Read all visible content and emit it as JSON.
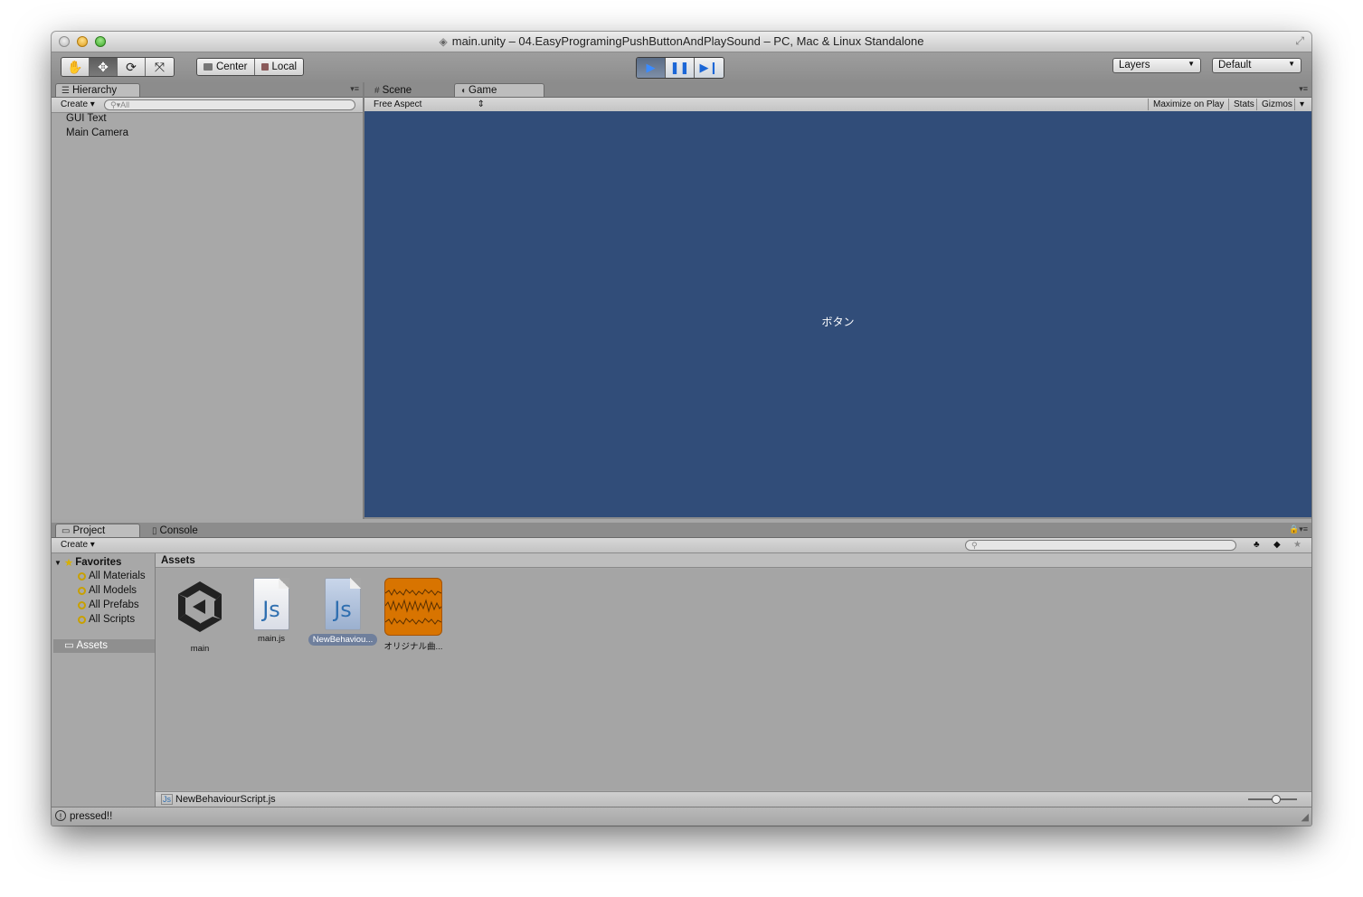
{
  "window": {
    "title": "main.unity – 04.EasyProgramingPushButtonAndPlaySound – PC, Mac & Linux Standalone"
  },
  "toolbar": {
    "transform_tools": [
      "hand-icon",
      "move-icon",
      "rotate-icon",
      "scale-icon"
    ],
    "active_tool": "move-icon",
    "pivot_label": "Center",
    "space_label": "Local",
    "play_controls": [
      "play-icon",
      "pause-icon",
      "step-icon"
    ],
    "layers_label": "Layers",
    "layout_label": "Default"
  },
  "hierarchy": {
    "tab_label": "Hierarchy",
    "create_label": "Create",
    "search_placeholder": "All",
    "items": [
      "GUI Text",
      "Main Camera"
    ]
  },
  "scene_tab": {
    "label": "Scene"
  },
  "game": {
    "tab_label": "Game",
    "aspect_label": "Free Aspect",
    "maximize_label": "Maximize on Play",
    "stats_label": "Stats",
    "gizmos_label": "Gizmos",
    "background_color": "#314d79",
    "button_text": "ボタン"
  },
  "project": {
    "tab_label": "Project",
    "console_tab_label": "Console",
    "create_label": "Create",
    "favorites_label": "Favorites",
    "favorites": [
      "All Materials",
      "All Models",
      "All Prefabs",
      "All Scripts"
    ],
    "assets_folder_label": "Assets",
    "breadcrumb": "Assets",
    "assets": [
      {
        "label": "main",
        "icon": "unity-scene-icon"
      },
      {
        "label": "main.js",
        "icon": "js-file-icon"
      },
      {
        "label": "NewBehaviou...",
        "icon": "js-file-icon",
        "selected": true
      },
      {
        "label": "オリジナル曲...",
        "icon": "audio-clip-icon"
      }
    ],
    "selected_path": "NewBehaviourScript.js"
  },
  "status": {
    "message": "pressed!!"
  }
}
